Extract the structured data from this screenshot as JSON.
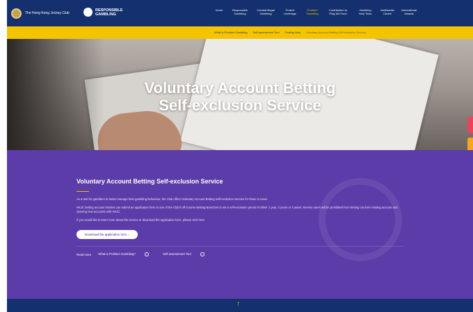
{
  "header": {
    "club_name": "The Hong Kong Jockey Club",
    "rg_logo_text": "RESPONSIBLE GAMBLING",
    "nav_items": [
      {
        "label": "Home"
      },
      {
        "label": "Responsible Gambling"
      },
      {
        "label": "Combat Illegal Gambling"
      },
      {
        "label": "Protect Underage"
      },
      {
        "label": "Problem Gambling"
      },
      {
        "label": "Contribution to Ping Wo Fund"
      },
      {
        "label": "Gambling Help Tools"
      },
      {
        "label": "Multimedia Centre"
      },
      {
        "label": "International Awards"
      }
    ],
    "active_nav_index": 4
  },
  "subnav": {
    "links": [
      {
        "label": "What is Problem Gambling"
      },
      {
        "label": "Self-assessment Tool"
      },
      {
        "label": "Finding Help"
      },
      {
        "label": "Voluntary Account Betting Self-exclusion Service"
      }
    ]
  },
  "hero": {
    "title_line1": "Voluntary Account Betting",
    "title_line2": "Self-exclusion Service"
  },
  "main": {
    "section_title": "Voluntary Account Betting Self-exclusion Service",
    "paragraphs": [
      "As a tool for gamblers to better manage their gambling behaviour, the Club offers Voluntary Account Betting Self-exclusion Service for those in need.",
      "HKJC betting account holders can submit an application form to one of the Club's off-Course Betting Branches to set a self-exclusion period of either 1 year, 2 years or 3 years. Service users will be prohibited from betting via their existing account and opening new accounts with HKJC.",
      "If you would like to learn more about the service or download the application form, please click here."
    ],
    "download_button": "Download the application form",
    "read_more_label": "Read more",
    "read_more_links": [
      {
        "label": "What is Problem Gambling?"
      },
      {
        "label": "Self-assessment Tool"
      }
    ]
  },
  "colors": {
    "navy": "#14306e",
    "yellow": "#f5c400",
    "purple": "#5b3ca8",
    "side_tabs": [
      "#e8455a",
      "#f5a623",
      "#2d8ee8",
      "#8a5cd0"
    ]
  },
  "footer": {
    "icon": "up-arrow-icon"
  }
}
